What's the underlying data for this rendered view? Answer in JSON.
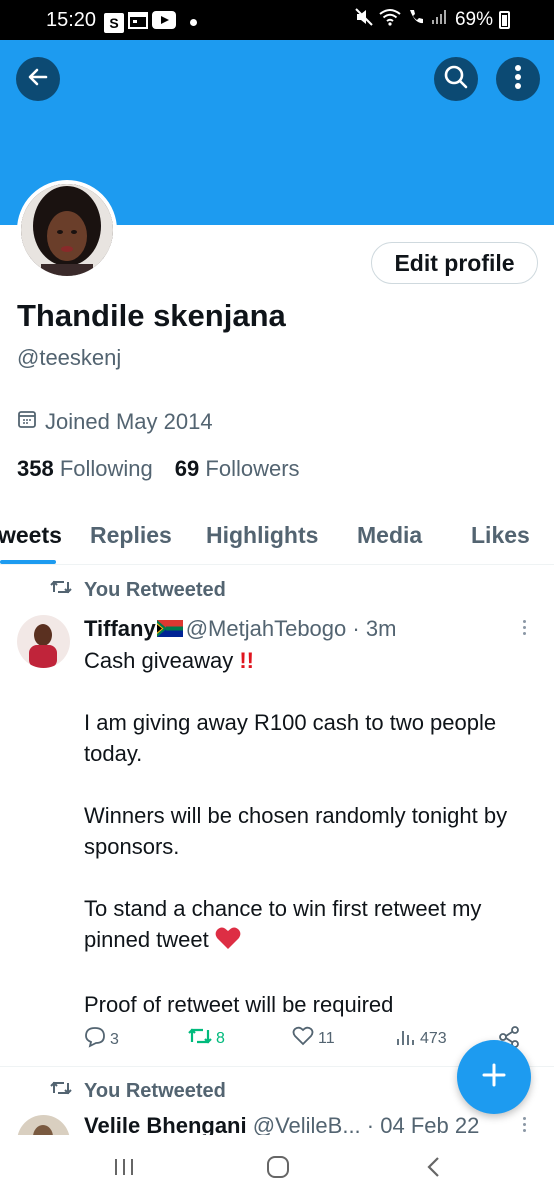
{
  "status_bar": {
    "time": "15:20",
    "app_icon_s": "S",
    "battery": "69%"
  },
  "profile": {
    "name": "Thandile skenjana",
    "handle": "@teeskenj",
    "joined": "Joined May 2014",
    "following_count": "358",
    "following_label": "Following",
    "followers_count": "69",
    "followers_label": "Followers",
    "edit_profile_label": "Edit profile"
  },
  "tabs": [
    {
      "label": "weets",
      "active": true
    },
    {
      "label": "Replies",
      "active": false
    },
    {
      "label": "Highlights",
      "active": false
    },
    {
      "label": "Media",
      "active": false
    },
    {
      "label": "Likes",
      "active": false
    }
  ],
  "tweets": [
    {
      "retweet_label": "You Retweeted",
      "author_name": "Tiffany",
      "author_handle": "@MetjahTebogo",
      "time": "· 3m",
      "lines": [
        "Cash  giveaway",
        "",
        "I am giving away R100 cash to two people today.",
        "",
        "Winners will be chosen randomly tonight by sponsors.",
        "",
        "To stand a chance to win first retweet my pinned tweet",
        "",
        "Proof of retweet will be required"
      ],
      "replies": "3",
      "retweets": "8",
      "likes": "11",
      "views": "473"
    },
    {
      "retweet_label": "You Retweeted",
      "author_name": "Velile Bhengani",
      "author_handle": "@VelileB...",
      "time": "· 04 Feb 22"
    }
  ],
  "colors": {
    "brand": "#1d9bf0",
    "banner": "#1d9bf0",
    "retweet_green": "#00ba7c",
    "text_secondary": "#536471"
  },
  "icons": [
    "back-arrow-icon",
    "search-icon",
    "more-vertical-icon",
    "calendar-icon",
    "retweet-icon",
    "reply-icon",
    "like-icon",
    "views-icon",
    "share-icon",
    "plus-icon"
  ]
}
